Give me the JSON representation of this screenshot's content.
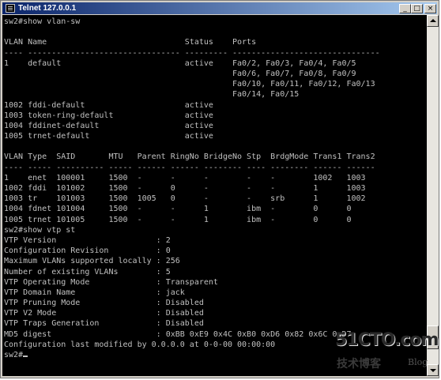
{
  "window": {
    "title": "Telnet 127.0.0.1",
    "minimize_glyph": "_",
    "maximize_glyph": "□",
    "close_glyph": "×"
  },
  "terminal": {
    "lines": [
      "sw2#show vlan-sw",
      "",
      "VLAN Name                             Status    Ports",
      "---- -------------------------------- --------- -------------------------------",
      "1    default                          active    Fa0/2, Fa0/3, Fa0/4, Fa0/5",
      "                                                Fa0/6, Fa0/7, Fa0/8, Fa0/9",
      "                                                Fa0/10, Fa0/11, Fa0/12, Fa0/13",
      "                                                Fa0/14, Fa0/15",
      "1002 fddi-default                     active",
      "1003 token-ring-default               active",
      "1004 fddinet-default                  active",
      "1005 trnet-default                    active",
      "",
      "VLAN Type  SAID       MTU   Parent RingNo BridgeNo Stp  BrdgMode Trans1 Trans2",
      "---- ----- ---------- ----- ------ ------ -------- ---- -------- ------ ------",
      "1    enet  100001     1500  -      -      -        -    -        1002   1003",
      "1002 fddi  101002     1500  -      0      -        -    -        1      1003",
      "1003 tr    101003     1500  1005   0      -        -    srb      1      1002",
      "1004 fdnet 101004     1500  -      -      1        ibm  -        0      0",
      "1005 trnet 101005     1500  -      -      1        ibm  -        0      0",
      "sw2#show vtp st",
      "VTP Version                     : 2",
      "Configuration Revision          : 0",
      "Maximum VLANs supported locally : 256",
      "Number of existing VLANs        : 5",
      "VTP Operating Mode              : Transparent",
      "VTP Domain Name                 : jack",
      "VTP Pruning Mode                : Disabled",
      "VTP V2 Mode                     : Disabled",
      "VTP Traps Generation            : Disabled",
      "MD5 digest                      : 0xBB 0xE9 0x4C 0xB0 0xD6 0x82 0x6C 0xD7",
      "Configuration last modified by 0.0.0.0 at 0-0-00 00:00:00",
      "sw2#"
    ]
  },
  "watermark": {
    "main": "51CTO.com",
    "sub": "技术博客",
    "blog": "Blog"
  }
}
